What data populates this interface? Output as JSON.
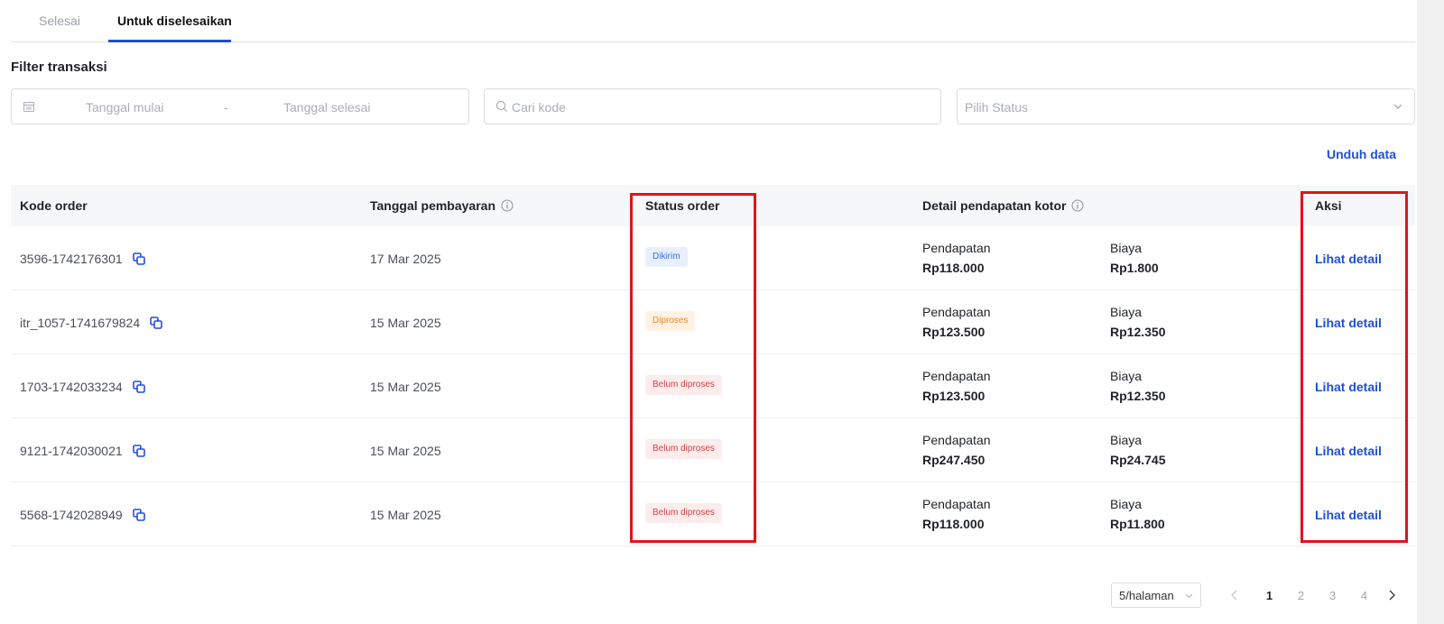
{
  "tabs": [
    {
      "label": "Selesai",
      "active": false
    },
    {
      "label": "Untuk diselesaikan",
      "active": true
    }
  ],
  "filter": {
    "title": "Filter transaksi",
    "start_date_placeholder": "Tanggal mulai",
    "separator": "-",
    "end_date_placeholder": "Tanggal selesai",
    "search_placeholder": "Cari kode",
    "status_placeholder": "Pilih Status",
    "download_label": "Unduh data"
  },
  "table": {
    "headers": {
      "code": "Kode order",
      "payment_date": "Tanggal pembayaran",
      "status": "Status order",
      "income_detail": "Detail pendapatan kotor",
      "action": "Aksi"
    },
    "rows": [
      {
        "code": "3596-1742176301",
        "date": "17 Mar 2025",
        "status": "Dikirim",
        "status_color": "blue",
        "revenue_label": "Pendapatan",
        "revenue": "Rp118.000",
        "fee_label": "Biaya",
        "fee": "Rp1.800",
        "action": "Lihat detail"
      },
      {
        "code": "itr_1057-1741679824",
        "date": "15 Mar 2025",
        "status": "Diproses",
        "status_color": "orange",
        "revenue_label": "Pendapatan",
        "revenue": "Rp123.500",
        "fee_label": "Biaya",
        "fee": "Rp12.350",
        "action": "Lihat detail"
      },
      {
        "code": "1703-1742033234",
        "date": "15 Mar 2025",
        "status": "Belum diproses",
        "status_color": "red",
        "revenue_label": "Pendapatan",
        "revenue": "Rp123.500",
        "fee_label": "Biaya",
        "fee": "Rp12.350",
        "action": "Lihat detail"
      },
      {
        "code": "9121-1742030021",
        "date": "15 Mar 2025",
        "status": "Belum diproses",
        "status_color": "red",
        "revenue_label": "Pendapatan",
        "revenue": "Rp247.450",
        "fee_label": "Biaya",
        "fee": "Rp24.745",
        "action": "Lihat detail"
      },
      {
        "code": "5568-1742028949",
        "date": "15 Mar 2025",
        "status": "Belum diproses",
        "status_color": "red",
        "revenue_label": "Pendapatan",
        "revenue": "Rp118.000",
        "fee_label": "Biaya",
        "fee": "Rp11.800",
        "action": "Lihat detail"
      }
    ]
  },
  "pagination": {
    "page_size": "5/halaman",
    "pages": [
      "1",
      "2",
      "3",
      "4"
    ],
    "current": "1"
  },
  "colors": {
    "accent": "#1f4fd8",
    "highlight": "#e0141c",
    "status_blue": "#3b6be0",
    "status_orange": "#f08a24",
    "status_red": "#d94040"
  }
}
